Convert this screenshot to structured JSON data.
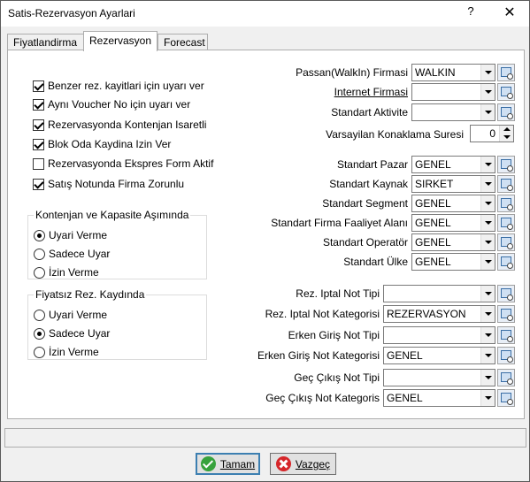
{
  "window": {
    "title": "Satis-Rezervasyon Ayarlari",
    "help": "?",
    "close": "✕"
  },
  "tabs": [
    {
      "label": "Fiyatlandirma"
    },
    {
      "label": "Rezervasyon",
      "active": true
    },
    {
      "label": "Forecast"
    }
  ],
  "checkboxes": [
    {
      "label": "Benzer rez. kayitlari için uyarı ver",
      "checked": true
    },
    {
      "label": "Aynı Voucher No için uyarı ver",
      "checked": true
    },
    {
      "label": "Rezervasyonda Kontenjan Isaretli",
      "checked": true
    },
    {
      "label": "Blok Oda Kaydina Izin Ver",
      "checked": true
    },
    {
      "label": "Rezervasyonda Ekspres Form Aktif",
      "checked": false
    },
    {
      "label": "Satış Notunda Firma Zorunlu",
      "checked": true
    }
  ],
  "group1": {
    "legend": "Kontenjan ve Kapasite Aşımında",
    "options": [
      {
        "label": "Uyari Verme",
        "selected": true
      },
      {
        "label": "Sadece Uyar",
        "selected": false
      },
      {
        "label": "İzin Verme",
        "selected": false
      }
    ]
  },
  "group2": {
    "legend": "Fiyatsız Rez. Kaydında",
    "options": [
      {
        "label": "Uyari Verme",
        "selected": false
      },
      {
        "label": "Sadece Uyar",
        "selected": true
      },
      {
        "label": "İzin Verme",
        "selected": false
      }
    ]
  },
  "right": {
    "passan_label": "Passan(WalkIn) Firmasi",
    "passan_value": "WALKIN",
    "internet_label": "Internet Firmasi",
    "internet_value": "",
    "aktivite_label": "Standart Aktivite",
    "aktivite_value": "",
    "konaklama_label": "Varsayilan Konaklama Suresi",
    "konaklama_value": "0",
    "pazar_label": "Standart Pazar",
    "pazar_value": "GENEL",
    "kaynak_label": "Standart Kaynak",
    "kaynak_value": "SIRKET",
    "segment_label": "Standart Segment",
    "segment_value": "GENEL",
    "faaliyet_label": "Standart Firma Faaliyet Alanı",
    "faaliyet_value": "GENEL",
    "operator_label": "Standart Operatör",
    "operator_value": "GENEL",
    "ulke_label": "Standart Ülke",
    "ulke_value": "GENEL",
    "iptal_tipi_label": "Rez. Iptal Not Tipi",
    "iptal_tipi_value": "",
    "iptal_kat_label": "Rez. Iptal Not Kategorisi",
    "iptal_kat_value": "REZERVASYON",
    "erken_tipi_label": "Erken Giriş Not Tipi",
    "erken_tipi_value": "",
    "erken_kat_label": "Erken Giriş Not Kategorisi",
    "erken_kat_value": "GENEL",
    "gec_tipi_label": "Geç Çıkış Not Tipi",
    "gec_tipi_value": "",
    "gec_kat_label": "Geç Çıkış Not Kategoris",
    "gec_kat_value": "GENEL"
  },
  "buttons": {
    "ok": "Tamam",
    "cancel": "Vazgeç"
  }
}
